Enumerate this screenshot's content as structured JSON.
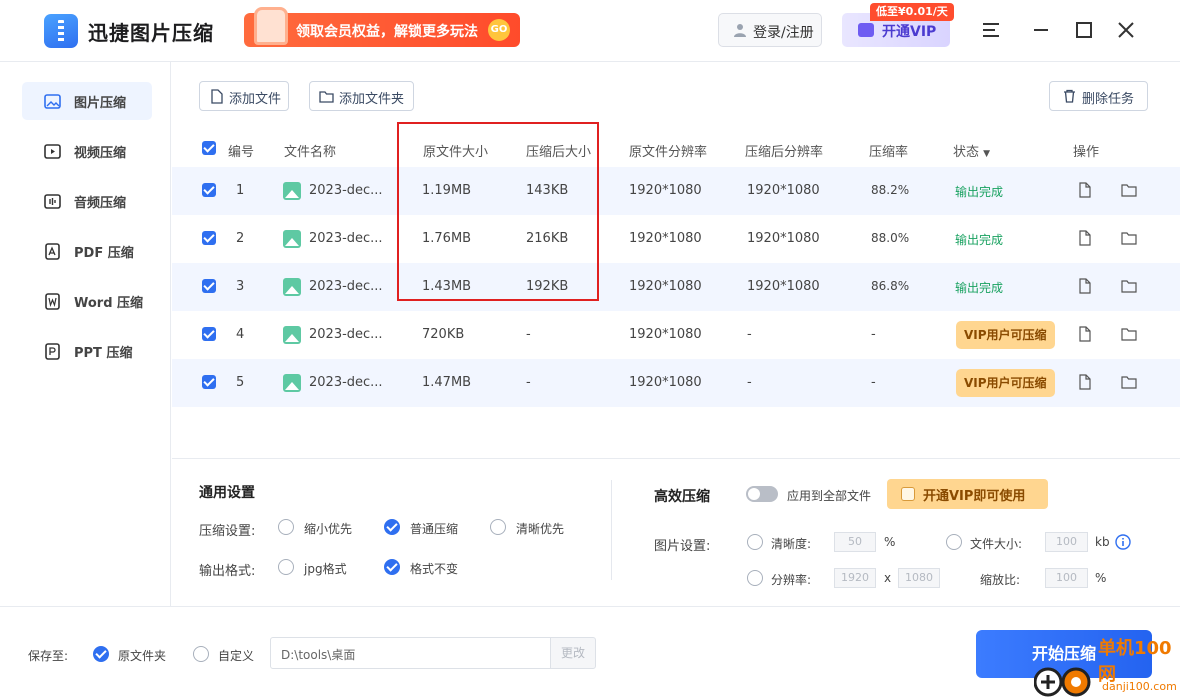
{
  "app": {
    "title": "迅捷图片压缩"
  },
  "header": {
    "promo": {
      "text": "领取会员权益，解锁更多玩法",
      "go": "GO"
    },
    "login": "登录/注册",
    "vip": "开通VIP",
    "vip_tag": "低至¥0.01/天"
  },
  "sidebar": {
    "items": [
      {
        "label": "图片压缩",
        "icon": "image-icon"
      },
      {
        "label": "视频压缩",
        "icon": "video-icon"
      },
      {
        "label": "音频压缩",
        "icon": "audio-icon"
      },
      {
        "label": "PDF 压缩",
        "icon": "pdf-icon"
      },
      {
        "label": "Word 压缩",
        "icon": "word-icon"
      },
      {
        "label": "PPT 压缩",
        "icon": "ppt-icon"
      }
    ]
  },
  "toolbar": {
    "add_file": "添加文件",
    "add_folder": "添加文件夹",
    "delete_task": "删除任务"
  },
  "table": {
    "headers": {
      "index": "编号",
      "name": "文件名称",
      "orig_size": "原文件大小",
      "comp_size": "压缩后大小",
      "orig_res": "原文件分辨率",
      "comp_res": "压缩后分辨率",
      "ratio": "压缩率",
      "status": "状态",
      "ops": "操作"
    },
    "rows": [
      {
        "index": "1",
        "name": "2023-dec...",
        "orig_size": "1.19MB",
        "comp_size": "143KB",
        "orig_res": "1920*1080",
        "comp_res": "1920*1080",
        "ratio": "88.2%",
        "status": "输出完成"
      },
      {
        "index": "2",
        "name": "2023-dec...",
        "orig_size": "1.76MB",
        "comp_size": "216KB",
        "orig_res": "1920*1080",
        "comp_res": "1920*1080",
        "ratio": "88.0%",
        "status": "输出完成"
      },
      {
        "index": "3",
        "name": "2023-dec...",
        "orig_size": "1.43MB",
        "comp_size": "192KB",
        "orig_res": "1920*1080",
        "comp_res": "1920*1080",
        "ratio": "86.8%",
        "status": "输出完成"
      },
      {
        "index": "4",
        "name": "2023-dec...",
        "orig_size": "720KB",
        "comp_size": "-",
        "orig_res": "1920*1080",
        "comp_res": "-",
        "ratio": "-",
        "status": "VIP用户可压缩"
      },
      {
        "index": "5",
        "name": "2023-dec...",
        "orig_size": "1.47MB",
        "comp_size": "-",
        "orig_res": "1920*1080",
        "comp_res": "-",
        "ratio": "-",
        "status": "VIP用户可压缩"
      }
    ]
  },
  "general": {
    "title": "通用设置",
    "compress_label": "压缩设置:",
    "compress_options": [
      "缩小优先",
      "普通压缩",
      "清晰优先"
    ],
    "compress_selected": "普通压缩",
    "format_label": "输出格式:",
    "format_options": [
      "jpg格式",
      "格式不变"
    ],
    "format_selected": "格式不变"
  },
  "efficient": {
    "title": "高效压缩",
    "apply_all": "应用到全部文件",
    "vip_use": "开通VIP即可使用",
    "image_settings": "图片设置:",
    "clarity": "清晰度:",
    "clarity_value": "50",
    "clarity_unit": "%",
    "file_size": "文件大小:",
    "file_size_value": "100",
    "file_size_unit": "kb",
    "resolution": "分辨率:",
    "res_w": "1920",
    "res_x": "x",
    "res_h": "1080",
    "scale": "缩放比:",
    "scale_value": "100",
    "scale_unit": "%"
  },
  "save": {
    "label": "保存至:",
    "orig_folder": "原文件夹",
    "custom": "自定义",
    "path": "D:\\tools\\桌面",
    "change": "更改"
  },
  "start": "开始压缩",
  "watermark": {
    "text": "单机100网",
    "url": "danji100.com"
  }
}
